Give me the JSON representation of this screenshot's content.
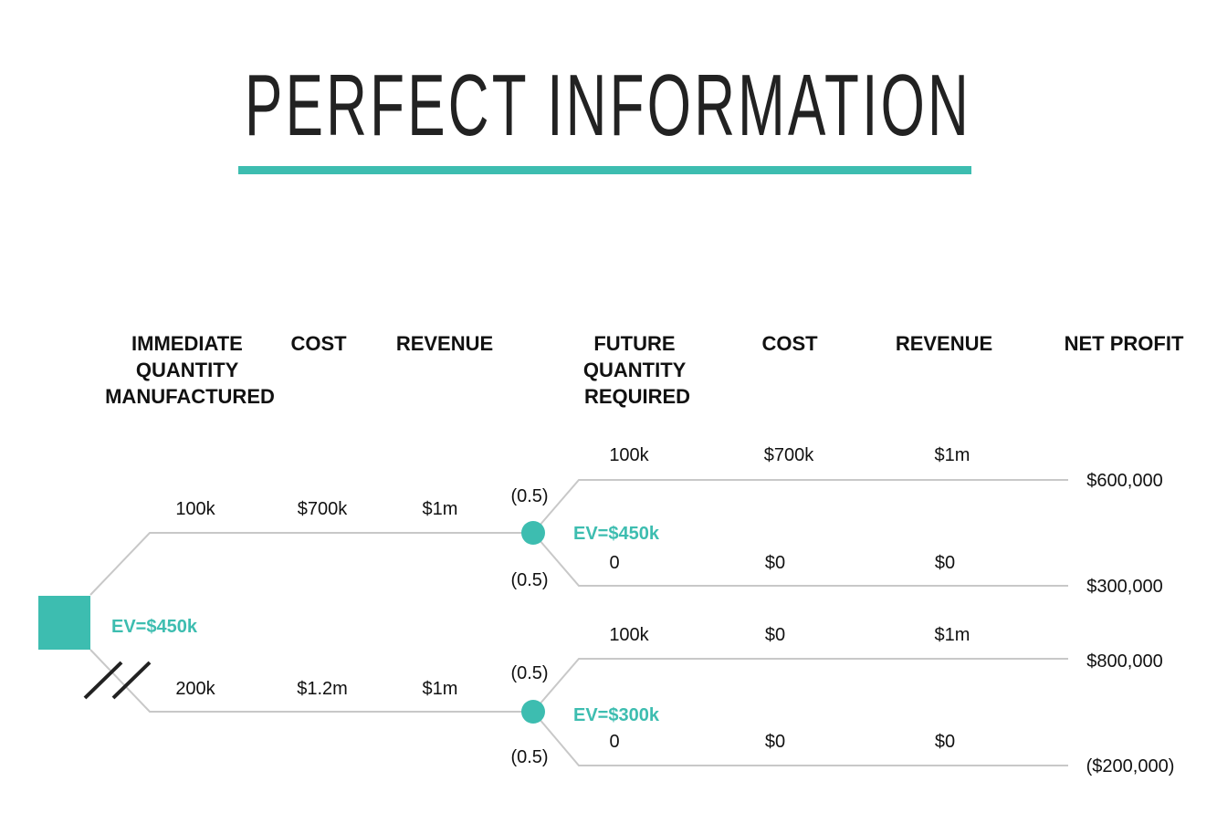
{
  "title": "PERFECT INFORMATION",
  "colors": {
    "accent": "#3dbdb0",
    "text": "#111111",
    "line": "#c8c8c8"
  },
  "headers": {
    "immediate_qty": [
      "IMMEDIATE",
      "QUANTITY",
      "MANUFACTURED"
    ],
    "cost1": "COST",
    "revenue1": "REVENUE",
    "future_qty": [
      "FUTURE",
      "QUANTITY",
      "REQUIRED"
    ],
    "cost2": "COST",
    "revenue2": "REVENUE",
    "net_profit": "NET PROFIT"
  },
  "root": {
    "ev": "EV=$450k"
  },
  "decisions": [
    {
      "quantity": "100k",
      "cost": "$700k",
      "revenue": "$1m",
      "ev": "EV=$450k",
      "rejected": false,
      "outcomes": [
        {
          "prob": "(0.5)",
          "quantity": "100k",
          "cost": "$700k",
          "revenue": "$1m",
          "net_profit": "$600,000"
        },
        {
          "prob": "(0.5)",
          "quantity": "0",
          "cost": "$0",
          "revenue": "$0",
          "net_profit": "$300,000"
        }
      ]
    },
    {
      "quantity": "200k",
      "cost": "$1.2m",
      "revenue": "$1m",
      "ev": "EV=$300k",
      "rejected": true,
      "outcomes": [
        {
          "prob": "(0.5)",
          "quantity": "100k",
          "cost": "$0",
          "revenue": "$1m",
          "net_profit": "$800,000"
        },
        {
          "prob": "(0.5)",
          "quantity": "0",
          "cost": "$0",
          "revenue": "$0",
          "net_profit": "($200,000)"
        }
      ]
    }
  ]
}
